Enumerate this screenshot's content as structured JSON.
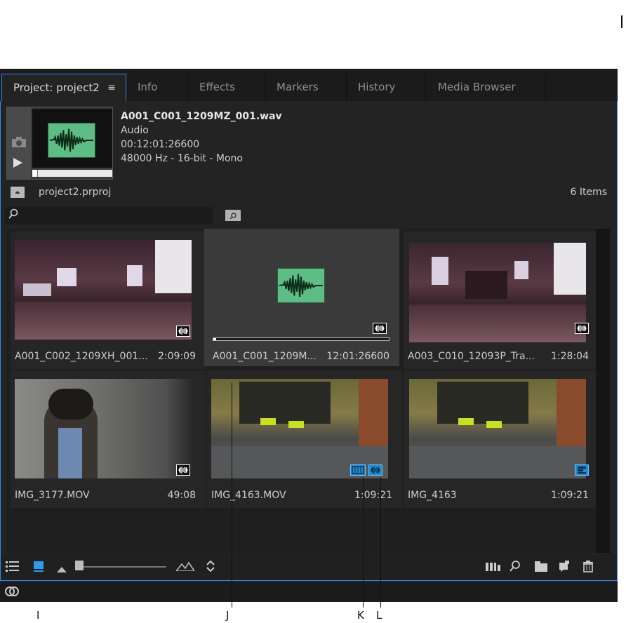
{
  "tabs": [
    {
      "label": "Project: project2",
      "active": true
    },
    {
      "label": "Info",
      "active": false
    },
    {
      "label": "Effects",
      "active": false
    },
    {
      "label": "Markers",
      "active": false
    },
    {
      "label": "History",
      "active": false
    },
    {
      "label": "Media Browser",
      "active": false
    }
  ],
  "tab_menu_glyph": "≡",
  "preview": {
    "clip_name": "A001_C001_1209MZ_001.wav",
    "clip_type": "Audio",
    "timecode": "00:12:01:26600",
    "format": "48000 Hz - 16-bit - Mono"
  },
  "project": {
    "file": "project2.prproj",
    "item_count": "6 Items"
  },
  "search": {
    "value": "",
    "placeholder": ""
  },
  "tiles": [
    {
      "name": "A001_C002_1209XH_001...",
      "duration": "2:09:09",
      "selected": false,
      "badges": [
        "audio-badge-icon"
      ]
    },
    {
      "name": "A001_C001_1209M...",
      "duration": "12:01:26600",
      "selected": true,
      "badges": [
        "audio-badge-icon"
      ]
    },
    {
      "name": "A003_C010_12093P_Tra...",
      "duration": "1:28:04",
      "selected": false,
      "badges": [
        "audio-badge-icon"
      ]
    },
    {
      "name": "IMG_3177.MOV",
      "duration": "49:08",
      "selected": false,
      "badges": [
        "audio-badge-icon"
      ]
    },
    {
      "name": "IMG_4163.MOV",
      "duration": "1:09:21",
      "selected": false,
      "badges": [
        "video-badge-icon",
        "audio-badge-icon"
      ]
    },
    {
      "name": "IMG_4163",
      "duration": "1:09:21",
      "selected": false,
      "badges": [
        "sequence-badge-icon"
      ]
    }
  ],
  "callouts": {
    "i": "I",
    "j": "J",
    "k": "K",
    "l": "L"
  },
  "colors": {
    "accent": "#2d8ceb",
    "waveform_bg": "#5ebc85",
    "panel_bg": "#232323"
  }
}
